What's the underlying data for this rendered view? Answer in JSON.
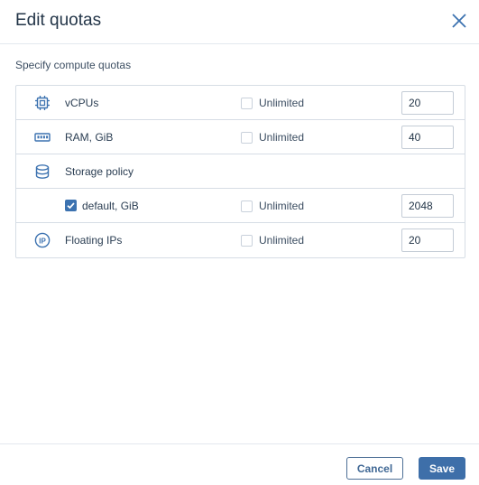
{
  "dialog": {
    "title": "Edit quotas",
    "close_icon": "close-icon",
    "subtitle": "Specify compute quotas"
  },
  "rows": [
    {
      "icon": "cpu-chip-icon",
      "label": "vCPUs",
      "unlimited_label": "Unlimited",
      "unlimited_checked": false,
      "value": "20"
    },
    {
      "icon": "memory-module-icon",
      "label": "RAM, GiB",
      "unlimited_label": "Unlimited",
      "unlimited_checked": false,
      "value": "40"
    },
    {
      "icon": "database-icon",
      "label": "Storage policy"
    },
    {
      "icon": "checkbox-checked-icon",
      "label": "default, GiB",
      "checked": true,
      "unlimited_label": "Unlimited",
      "unlimited_checked": false,
      "value": "2048"
    },
    {
      "icon": "floating-ip-icon",
      "label": "Floating IPs",
      "unlimited_label": "Unlimited",
      "unlimited_checked": false,
      "value": "20"
    }
  ],
  "footer": {
    "cancel_label": "Cancel",
    "save_label": "Save"
  },
  "colors": {
    "accent": "#3e6fa9",
    "icon": "#3c72b0",
    "border": "#d6dde5"
  }
}
